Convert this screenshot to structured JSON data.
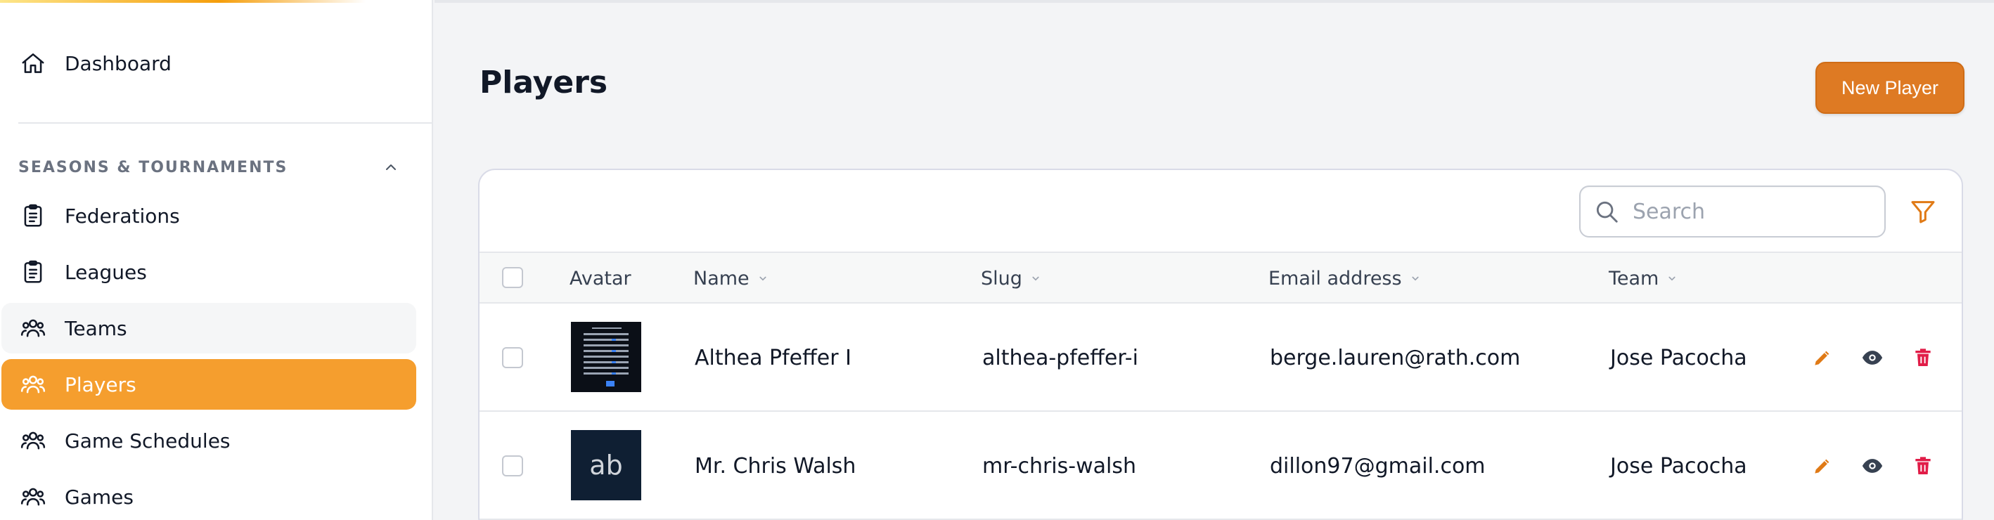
{
  "sidebar": {
    "top_items": [
      {
        "label": "Dashboard",
        "icon": "home-icon"
      }
    ],
    "group": {
      "label": "SEASONS & TOURNAMENTS",
      "expanded": true
    },
    "items": [
      {
        "label": "Federations",
        "icon": "clipboard-icon"
      },
      {
        "label": "Leagues",
        "icon": "clipboard-icon"
      },
      {
        "label": "Teams",
        "icon": "users-icon",
        "state": "hover"
      },
      {
        "label": "Players",
        "icon": "users-icon",
        "state": "active"
      },
      {
        "label": "Game Schedules",
        "icon": "users-icon"
      },
      {
        "label": "Games",
        "icon": "users-icon"
      }
    ]
  },
  "page": {
    "title": "Players",
    "new_button": "New Player"
  },
  "table": {
    "search_placeholder": "Search",
    "columns": [
      "Avatar",
      "Name",
      "Slug",
      "Email address",
      "Team"
    ],
    "rows": [
      {
        "name": "Althea Pfeffer I",
        "slug": "althea-pfeffer-i",
        "email": "berge.lauren@rath.com",
        "team": "Jose Pacocha",
        "avatar": "image-thumbnail"
      },
      {
        "name": "Mr. Chris Walsh",
        "slug": "mr-chris-walsh",
        "email": "dillon97@gmail.com",
        "team": "Jose Pacocha",
        "avatar_initials": "ab"
      }
    ]
  },
  "colors": {
    "accent": "#f59e2e",
    "button": "#de7a23",
    "edit": "#e07a16",
    "delete": "#e11d48",
    "view": "#374151"
  }
}
